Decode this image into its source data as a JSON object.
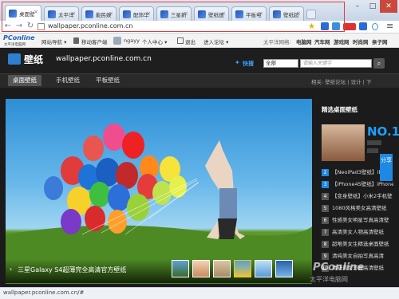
{
  "browser": {
    "tabs": [
      {
        "title": "桌面壁"
      },
      {
        "title": "太平洋"
      },
      {
        "title": "能民娱"
      },
      {
        "title": "配饰华"
      },
      {
        "title": "三星新"
      },
      {
        "title": "壁纸画"
      },
      {
        "title": "平板电"
      },
      {
        "title": "壁纸超"
      }
    ],
    "window_controls": [
      "–",
      "□",
      "✕"
    ],
    "url": "wallpaper.pconline.com.cn",
    "status_text": "wallpaper.pconline.com.cn/#",
    "colors": {
      "annotation_box": "#e23a3a"
    }
  },
  "site_top": {
    "logo_text": "PConline",
    "logo_sub": "太平洋电脑网",
    "links": [
      "网站导航 ▾",
      "移动客户端",
      "ngayy",
      "个人中心 ▾",
      "退出",
      "进入论坛 ▾"
    ],
    "right_label": "太平洋网络:",
    "right_links": [
      "电脑网",
      "汽车网",
      "游戏网",
      "时尚网",
      "亲子网"
    ]
  },
  "header": {
    "title": "壁纸",
    "url": "wallpaper.pconline.com.cn",
    "fast_label": "快搜",
    "select_value": "全部",
    "keyword_placeholder": "请输入关键字",
    "search_icon": "search-icon"
  },
  "subnav": {
    "items": [
      "桌面壁纸",
      "手机壁纸",
      "平板壁纸"
    ],
    "right": "相关: 壁纸论坛 | 设计 | 下"
  },
  "hero": {
    "caption": "三星Galaxy S4超薄完全高清官方壁纸"
  },
  "right": {
    "title": "精选桌面壁纸",
    "no1": "NO.1",
    "list": [
      {
        "n": "2",
        "t": "【NeoiPad3壁纸】iPad"
      },
      {
        "n": "3",
        "t": "【iPhone4S壁纸】iPhone"
      },
      {
        "n": "4",
        "t": "【变身壁纸】小米2手机壁"
      },
      {
        "n": "5",
        "t": "1080风格美女高清壁纸"
      },
      {
        "n": "6",
        "t": "性感美女明星写真高清壁"
      },
      {
        "n": "7",
        "t": "高清美女人物高清壁纸"
      },
      {
        "n": "8",
        "t": "超唯美女生精选桌面壁纸"
      },
      {
        "n": "9",
        "t": "清纯美女自拍写真高清"
      },
      {
        "n": "10",
        "t": "清新美女写真高清壁纸"
      }
    ],
    "share": "分享"
  },
  "watermark": {
    "brand": "PConline",
    "sub": "太平洋电脑网"
  }
}
